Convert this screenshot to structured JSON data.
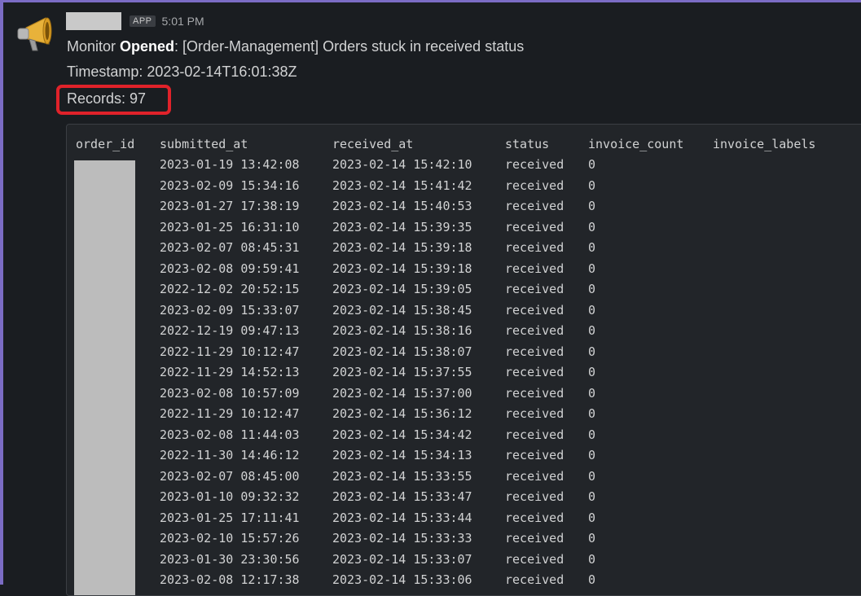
{
  "message": {
    "app_badge": "APP",
    "time": "5:01 PM",
    "line1_prefix": "Monitor ",
    "line1_status": "Opened",
    "line1_suffix": ": [Order-Management] Orders stuck in received status",
    "timestamp_line": "Timestamp: 2023-02-14T16:01:38Z",
    "records_line": "Records: 97"
  },
  "table": {
    "headers": [
      "order_id",
      "submitted_at",
      "received_at",
      "status",
      "invoice_count",
      "invoice_labels"
    ],
    "rows": [
      [
        "2023-01-19 13:42:08",
        "2023-02-14 15:42:10",
        "received",
        "0"
      ],
      [
        "2023-02-09 15:34:16",
        "2023-02-14 15:41:42",
        "received",
        "0"
      ],
      [
        "2023-01-27 17:38:19",
        "2023-02-14 15:40:53",
        "received",
        "0"
      ],
      [
        "2023-01-25 16:31:10",
        "2023-02-14 15:39:35",
        "received",
        "0"
      ],
      [
        "2023-02-07 08:45:31",
        "2023-02-14 15:39:18",
        "received",
        "0"
      ],
      [
        "2023-02-08 09:59:41",
        "2023-02-14 15:39:18",
        "received",
        "0"
      ],
      [
        "2022-12-02 20:52:15",
        "2023-02-14 15:39:05",
        "received",
        "0"
      ],
      [
        "2023-02-09 15:33:07",
        "2023-02-14 15:38:45",
        "received",
        "0"
      ],
      [
        "2022-12-19 09:47:13",
        "2023-02-14 15:38:16",
        "received",
        "0"
      ],
      [
        "2022-11-29 10:12:47",
        "2023-02-14 15:38:07",
        "received",
        "0"
      ],
      [
        "2022-11-29 14:52:13",
        "2023-02-14 15:37:55",
        "received",
        "0"
      ],
      [
        "2023-02-08 10:57:09",
        "2023-02-14 15:37:00",
        "received",
        "0"
      ],
      [
        "2022-11-29 10:12:47",
        "2023-02-14 15:36:12",
        "received",
        "0"
      ],
      [
        "2023-02-08 11:44:03",
        "2023-02-14 15:34:42",
        "received",
        "0"
      ],
      [
        "2022-11-30 14:46:12",
        "2023-02-14 15:34:13",
        "received",
        "0"
      ],
      [
        "2023-02-07 08:45:00",
        "2023-02-14 15:33:55",
        "received",
        "0"
      ],
      [
        "2023-01-10 09:32:32",
        "2023-02-14 15:33:47",
        "received",
        "0"
      ],
      [
        "2023-01-25 17:11:41",
        "2023-02-14 15:33:44",
        "received",
        "0"
      ],
      [
        "2023-02-10 15:57:26",
        "2023-02-14 15:33:33",
        "received",
        "0"
      ],
      [
        "2023-01-30 23:30:56",
        "2023-02-14 15:33:07",
        "received",
        "0"
      ],
      [
        "2023-02-08 12:17:38",
        "2023-02-14 15:33:06",
        "received",
        "0"
      ]
    ]
  },
  "icons": {
    "avatar": "megaphone-icon"
  },
  "colors": {
    "highlight": "#e0222a",
    "frame": "#7b6cc4"
  }
}
